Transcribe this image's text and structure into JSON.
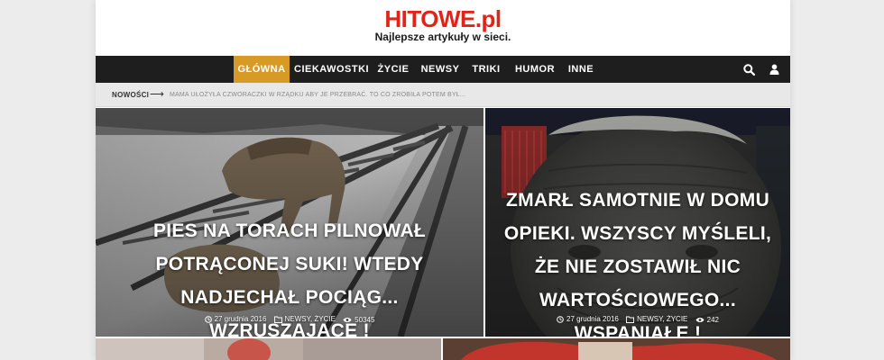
{
  "site": {
    "logo": "HITOWE.pl",
    "tagline": "Najlepsze artykuły w sieci."
  },
  "nav": {
    "items": [
      {
        "label": "GŁÓWNA",
        "active": true
      },
      {
        "label": "CIEKAWOSTKI"
      },
      {
        "label": "ŻYCIE"
      },
      {
        "label": "NEWSY"
      },
      {
        "label": "TRIKI"
      },
      {
        "label": "HUMOR"
      },
      {
        "label": "INNE"
      }
    ],
    "icons": [
      "search-icon",
      "user-icon"
    ]
  },
  "ticker": {
    "label": "NOWOŚCI",
    "text": "MAMA UŁOŻYŁA CZWORACZKI W RZĄDKU ABY JE PRZEBRAĆ. TO CO ZROBIŁA POTEM BYŁ..."
  },
  "cards": [
    {
      "title": "PIES NA TORACH PILNOWAŁ POTRĄCONEJ SUKI! WTEDY NADJECHAŁ POCIĄG... WZRUSZAJĄCE !",
      "date": "27 grudnia 2016",
      "categories": "NEWSY, ŻYCIE",
      "views": "50345"
    },
    {
      "title": "ZMARŁ SAMOTNIE W DOMU OPIEKI. WSZYSCY MYŚLELI, ŻE NIE ZOSTAWIŁ NIC WARTOŚCIOWEGO... WSPANIAŁE !",
      "date": "27 grudnia 2016",
      "categories": "NEWSY, ŻYCIE",
      "views": "242"
    }
  ],
  "colors": {
    "logo": "#e2231a",
    "nav_bg": "#1e1e1e",
    "nav_active": "#d79a25",
    "ticker_bg": "#e8e8e8"
  }
}
